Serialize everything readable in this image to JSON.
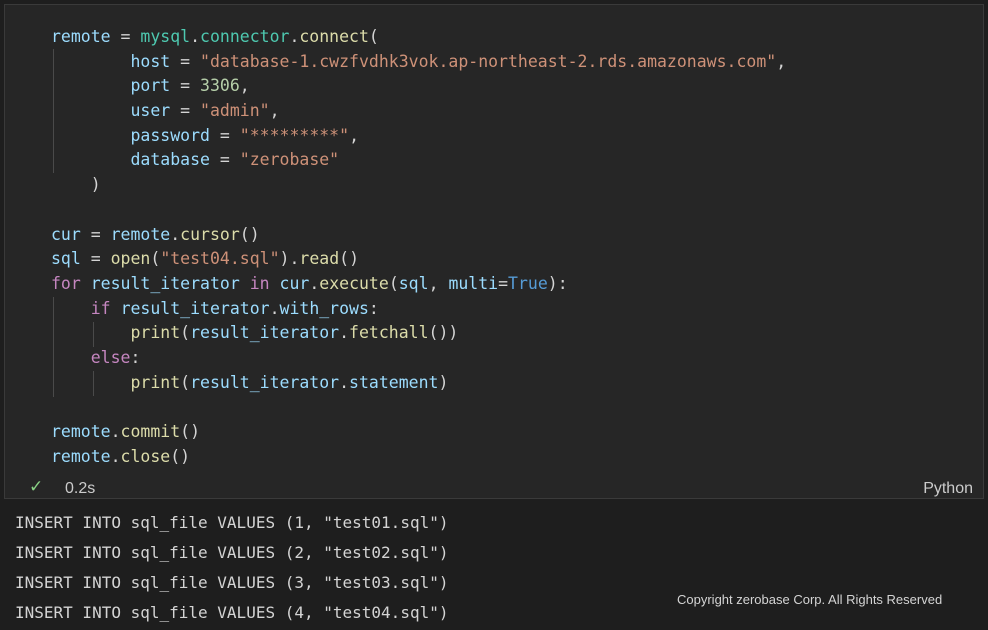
{
  "cell": {
    "code_lines": [
      [
        [
          "v",
          "remote"
        ],
        [
          "o",
          " = "
        ],
        [
          "c",
          "mysql"
        ],
        [
          "o",
          "."
        ],
        [
          "c",
          "connector"
        ],
        [
          "o",
          "."
        ],
        [
          "f",
          "connect"
        ],
        [
          "o",
          "("
        ]
      ],
      [
        [
          "o",
          "        "
        ],
        [
          "v",
          "host"
        ],
        [
          "o",
          " = "
        ],
        [
          "s",
          "\"database-1.cwzfvdhk3vok.ap-northeast-2.rds.amazonaws.com\""
        ],
        [
          "o",
          ","
        ]
      ],
      [
        [
          "o",
          "        "
        ],
        [
          "v",
          "port"
        ],
        [
          "o",
          " = "
        ],
        [
          "n",
          "3306"
        ],
        [
          "o",
          ","
        ]
      ],
      [
        [
          "o",
          "        "
        ],
        [
          "v",
          "user"
        ],
        [
          "o",
          " = "
        ],
        [
          "s",
          "\"admin\""
        ],
        [
          "o",
          ","
        ]
      ],
      [
        [
          "o",
          "        "
        ],
        [
          "v",
          "password"
        ],
        [
          "o",
          " = "
        ],
        [
          "s",
          "\"*********\""
        ],
        [
          "o",
          ","
        ]
      ],
      [
        [
          "o",
          "        "
        ],
        [
          "v",
          "database"
        ],
        [
          "o",
          " = "
        ],
        [
          "s",
          "\"zerobase\""
        ]
      ],
      [
        [
          "o",
          "    )"
        ]
      ],
      [],
      [
        [
          "v",
          "cur"
        ],
        [
          "o",
          " = "
        ],
        [
          "v",
          "remote"
        ],
        [
          "o",
          "."
        ],
        [
          "f",
          "cursor"
        ],
        [
          "o",
          "()"
        ]
      ],
      [
        [
          "v",
          "sql"
        ],
        [
          "o",
          " = "
        ],
        [
          "f",
          "open"
        ],
        [
          "o",
          "("
        ],
        [
          "s",
          "\"test04.sql\""
        ],
        [
          "o",
          ")."
        ],
        [
          "f",
          "read"
        ],
        [
          "o",
          "()"
        ]
      ],
      [
        [
          "k",
          "for"
        ],
        [
          "o",
          " "
        ],
        [
          "v",
          "result_iterator"
        ],
        [
          "o",
          " "
        ],
        [
          "k",
          "in"
        ],
        [
          "o",
          " "
        ],
        [
          "v",
          "cur"
        ],
        [
          "o",
          "."
        ],
        [
          "f",
          "execute"
        ],
        [
          "o",
          "("
        ],
        [
          "v",
          "sql"
        ],
        [
          "o",
          ", "
        ],
        [
          "v",
          "multi"
        ],
        [
          "o",
          "="
        ],
        [
          "b",
          "True"
        ],
        [
          "o",
          "):"
        ]
      ],
      [
        [
          "o",
          "    "
        ],
        [
          "k",
          "if"
        ],
        [
          "o",
          " "
        ],
        [
          "v",
          "result_iterator"
        ],
        [
          "o",
          "."
        ],
        [
          "v",
          "with_rows"
        ],
        [
          "o",
          ":"
        ]
      ],
      [
        [
          "o",
          "        "
        ],
        [
          "f",
          "print"
        ],
        [
          "o",
          "("
        ],
        [
          "v",
          "result_iterator"
        ],
        [
          "o",
          "."
        ],
        [
          "f",
          "fetchall"
        ],
        [
          "o",
          "())"
        ]
      ],
      [
        [
          "o",
          "    "
        ],
        [
          "k",
          "else"
        ],
        [
          "o",
          ":"
        ]
      ],
      [
        [
          "o",
          "        "
        ],
        [
          "f",
          "print"
        ],
        [
          "o",
          "("
        ],
        [
          "v",
          "result_iterator"
        ],
        [
          "o",
          "."
        ],
        [
          "v",
          "statement"
        ],
        [
          "o",
          ")"
        ]
      ],
      [],
      [
        [
          "v",
          "remote"
        ],
        [
          "o",
          "."
        ],
        [
          "f",
          "commit"
        ],
        [
          "o",
          "()"
        ]
      ],
      [
        [
          "v",
          "remote"
        ],
        [
          "o",
          "."
        ],
        [
          "f",
          "close"
        ],
        [
          "o",
          "()"
        ]
      ]
    ],
    "status": {
      "check_icon": "check-icon",
      "check_glyph": "✓",
      "exec_time": "0.2s",
      "language": "Python"
    }
  },
  "output": {
    "lines": [
      "INSERT INTO sql_file VALUES (1, \"test01.sql\")",
      "INSERT INTO sql_file VALUES (2, \"test02.sql\")",
      "INSERT INTO sql_file VALUES (3, \"test03.sql\")",
      "INSERT INTO sql_file VALUES (4, \"test04.sql\")"
    ]
  },
  "copyright": "Copyright zerobase Corp. All Rights Reserved",
  "colors": {
    "background": "#1e1e1e",
    "cell_background": "#262626",
    "success": "#89d185"
  }
}
